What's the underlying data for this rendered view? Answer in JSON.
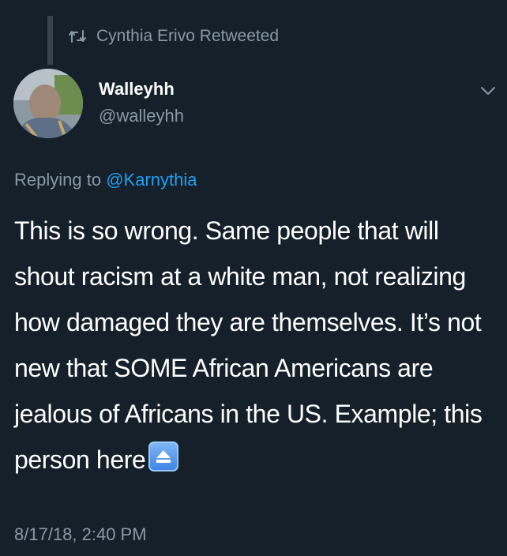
{
  "retweet": {
    "icon": "retweet-icon",
    "text": "Cynthia Erivo Retweeted"
  },
  "author": {
    "name": "Walleyhh",
    "handle": "@walleyhh",
    "avatar_icon": "avatar-photo"
  },
  "reply": {
    "prefix": "Replying to",
    "mention": "@Karnythia"
  },
  "tweet": {
    "text": "This is so wrong. Same people that will shout racism at a white man, not realizing how damaged they are themselves. It’s not new that SOME African Americans are jealous of Africans in the US. Example; this person here",
    "emoji": "eject-button-emoji"
  },
  "timestamp": "8/17/18, 2:40 PM",
  "menu_icon": "chevron-down-icon",
  "colors": {
    "background": "#15202b",
    "secondary_text": "#8899a6",
    "link": "#1da1f2"
  }
}
